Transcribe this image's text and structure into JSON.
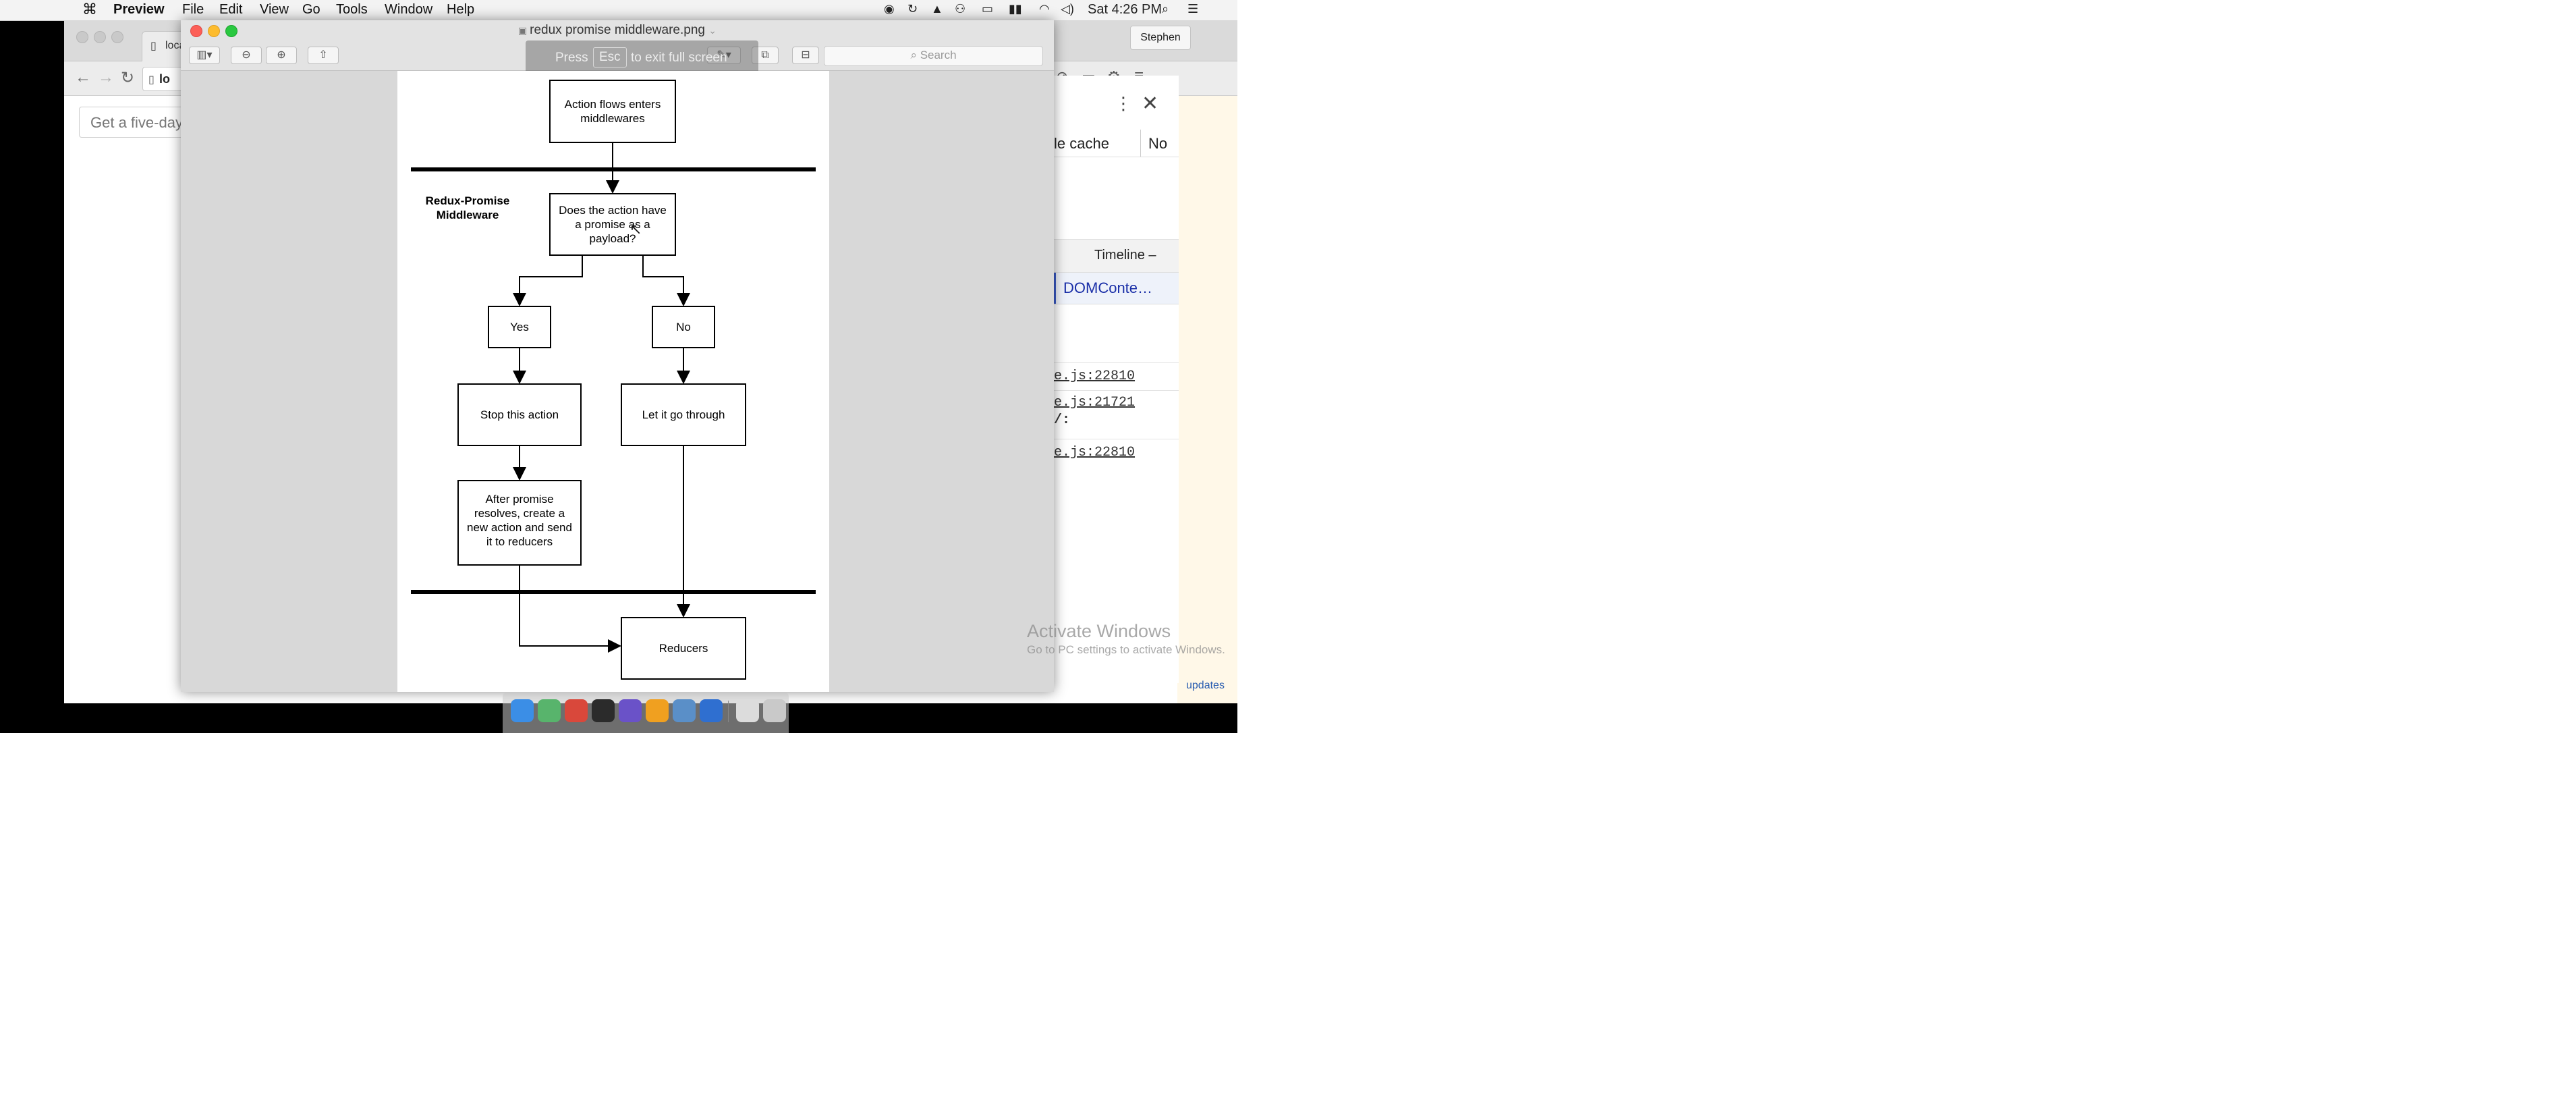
{
  "menubar": {
    "app": "Preview",
    "items": [
      "File",
      "Edit",
      "View",
      "Go",
      "Tools",
      "Window",
      "Help"
    ],
    "clock": "Sat 4:26 PM"
  },
  "browser": {
    "tab_label": "loca",
    "address_label": "lo",
    "search_placeholder": "Get a five-day",
    "user_button": "Stephen"
  },
  "devtools": {
    "disable_cache": "le cache",
    "no_label": "No",
    "timeline_label": "Timeline –",
    "event_label": "DOMConte…",
    "log_line_1": "e.js:22810",
    "log_line_2": "e.js:21721",
    "log_line_2b": "/:",
    "log_line_3": "e.js:22810",
    "updates": "updates"
  },
  "preview": {
    "title": "redux promise middleware.png",
    "search_placeholder": "Search",
    "fullscreen_hint_press": "Press",
    "fullscreen_hint_key": "Esc",
    "fullscreen_hint_rest": "to exit full screen"
  },
  "diagram": {
    "section_label_line1": "Redux-Promise",
    "section_label_line2": "Middleware",
    "box_enter_line1": "Action flows enters",
    "box_enter_line2": "middlewares",
    "box_question_line1": "Does the action have",
    "box_question_line2": "a promise as a",
    "box_question_line3": "payload?",
    "box_yes": "Yes",
    "box_no": "No",
    "box_stop": "Stop this action",
    "box_let": "Let it go through",
    "box_after_line1": "After promise",
    "box_after_line2": "resolves, create a",
    "box_after_line3": "new action and send",
    "box_after_line4": "it to reducers",
    "box_reducers": "Reducers"
  },
  "watermark": {
    "title": "Activate Windows",
    "subtitle": "Go to PC settings to activate Windows."
  },
  "dock": {
    "icons": [
      "finder-icon",
      "siri-icon",
      "chrome-icon",
      "terminal-icon",
      "launchpad-icon",
      "sublime-icon",
      "preview-icon",
      "app-store-icon",
      "documents-icon",
      "trash-icon"
    ],
    "icon_colors": [
      "#3b8ee6",
      "#58b46c",
      "#d9483b",
      "#2b2b2b",
      "#6a52c8",
      "#f0a020",
      "#5a8fc8",
      "#2f6fd0",
      "#dcdcdc",
      "#c9c9c9"
    ]
  }
}
